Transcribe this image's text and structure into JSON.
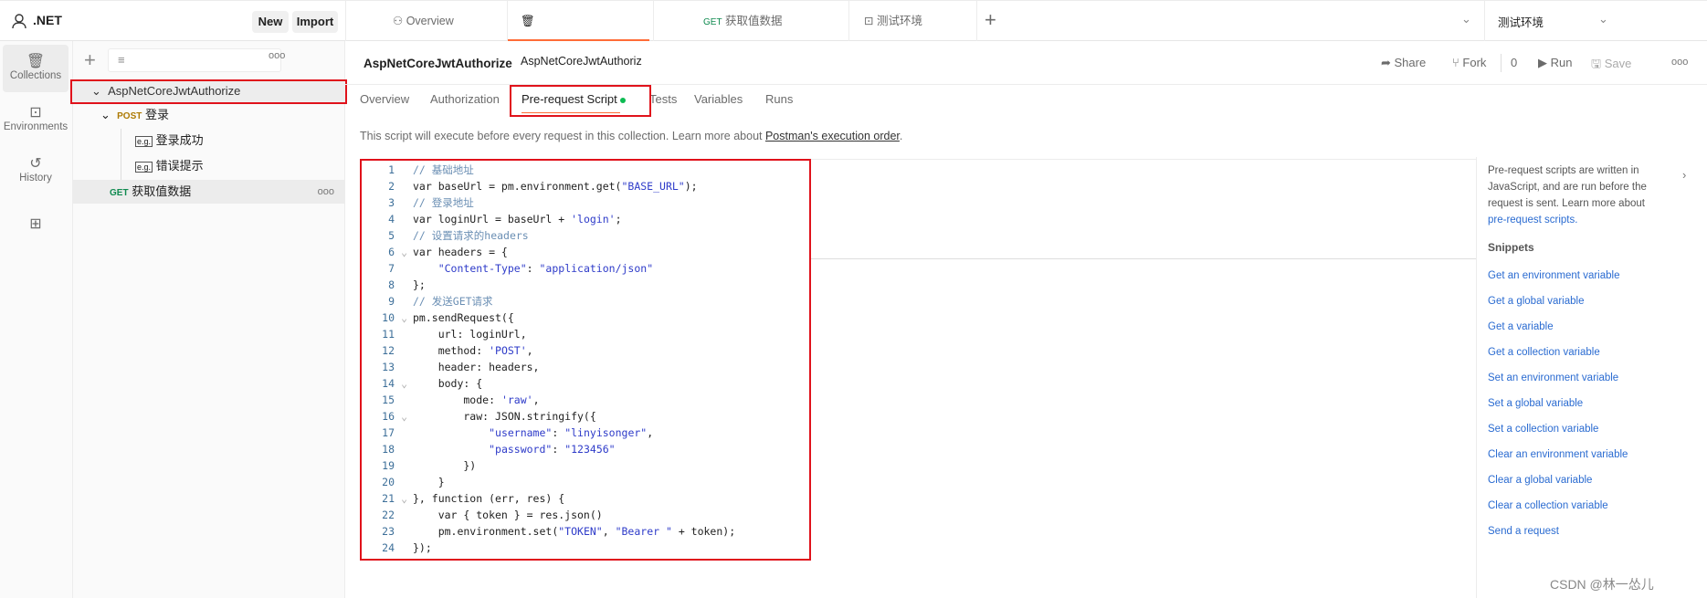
{
  "workspace": {
    "name": ".NET",
    "new_label": "New",
    "import_label": "Import"
  },
  "top_tabs": [
    {
      "label": "Overview",
      "icon": "overview-icon"
    },
    {
      "label": "AspNetCoreJwtAuthoriz",
      "icon": "collection-icon",
      "active": true
    },
    {
      "method": "GET",
      "label": "获取值数据"
    },
    {
      "label": "测试环境",
      "icon": "environment-icon"
    }
  ],
  "environment_selector": {
    "value": "测试环境"
  },
  "rail": [
    {
      "label": "Collections",
      "icon": "collections-icon",
      "active": true
    },
    {
      "label": "Environments",
      "icon": "environments-icon"
    },
    {
      "label": "History",
      "icon": "history-icon"
    },
    {
      "label": "",
      "icon": "add-workspace-icon"
    }
  ],
  "tree": {
    "collection": "AspNetCoreJwtAuthorize",
    "request": {
      "method": "POST",
      "name": "登录"
    },
    "examples": [
      "登录成功",
      "错误提示"
    ],
    "get_request": {
      "method": "GET",
      "name": "获取值数据"
    }
  },
  "header": {
    "title": "AspNetCoreJwtAuthorize",
    "share": "Share",
    "fork": "Fork",
    "fork_count": "0",
    "run": "Run",
    "save": "Save"
  },
  "tabs": [
    "Overview",
    "Authorization",
    "Pre-request Script",
    "Tests",
    "Variables",
    "Runs"
  ],
  "active_tab": "Pre-request Script",
  "description": {
    "text": "This script will execute before every request in this collection. Learn more about ",
    "link": "Postman's execution order",
    "end": "."
  },
  "code": [
    "// 基础地址",
    "var baseUrl = pm.environment.get(\"BASE_URL\");",
    "// 登录地址",
    "var loginUrl = baseUrl + 'login';",
    "// 设置请求的headers",
    "var headers = {",
    "    \"Content-Type\": \"application/json\"",
    "};",
    "// 发送GET请求",
    "pm.sendRequest({",
    "    url: loginUrl,",
    "    method: 'POST',",
    "    header: headers,",
    "    body: {",
    "        mode: 'raw',",
    "        raw: JSON.stringify({",
    "            \"username\": \"linyisonger\",",
    "            \"password\": \"123456\"",
    "        })",
    "    }",
    "}, function (err, res) {",
    "    var { token } = res.json()",
    "    pm.environment.set(\"TOKEN\", \"Bearer \" + token);",
    "});"
  ],
  "right_panel": {
    "line1": "Pre-request scripts are written in",
    "line2": "JavaScript, and are run before the",
    "line3": "request is sent. Learn more about",
    "link": "pre-request scripts.",
    "snippets_title": "Snippets",
    "snippets": [
      "Get an environment variable",
      "Get a global variable",
      "Get a variable",
      "Get a collection variable",
      "Set an environment variable",
      "Set a global variable",
      "Set a collection variable",
      "Clear an environment variable",
      "Clear a global variable",
      "Clear a collection variable",
      "Send a request"
    ]
  },
  "watermark": "CSDN @林一怂儿",
  "colors": {
    "accent": "#ff6c37",
    "post": "#ad7a03",
    "get": "#0f8a4f",
    "link": "#2a6bd1",
    "highlight": "#e0121b"
  }
}
